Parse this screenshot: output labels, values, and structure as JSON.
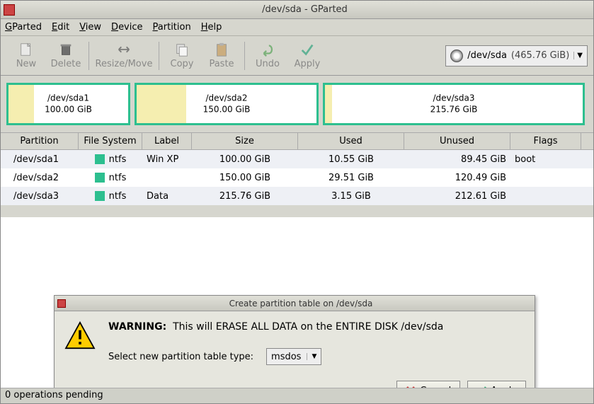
{
  "titlebar": {
    "title": "/dev/sda - GParted"
  },
  "menu": {
    "gparted": "GParted",
    "edit": "Edit",
    "view": "View",
    "device": "Device",
    "partition": "Partition",
    "help": "Help"
  },
  "toolbar": {
    "new": "New",
    "delete": "Delete",
    "resize": "Resize/Move",
    "copy": "Copy",
    "paste": "Paste",
    "undo": "Undo",
    "apply": "Apply"
  },
  "device": {
    "name": "/dev/sda",
    "size": "(465.76 GiB)"
  },
  "partitions": [
    {
      "name": "/dev/sda1",
      "fs": "ntfs",
      "label": "Win XP",
      "size": "100.00 GiB",
      "used": "10.55 GiB",
      "unused": "89.45 GiB",
      "flags": "boot",
      "vis_width": 175,
      "vis_used": 36
    },
    {
      "name": "/dev/sda2",
      "fs": "ntfs",
      "label": "",
      "size": "150.00 GiB",
      "used": "29.51 GiB",
      "unused": "120.49 GiB",
      "flags": "",
      "vis_width": 260,
      "vis_used": 70
    },
    {
      "name": "/dev/sda3",
      "fs": "ntfs",
      "label": "Data",
      "size": "215.76 GiB",
      "used": "3.15 GiB",
      "unused": "212.61 GiB",
      "flags": "",
      "vis_width": 370,
      "vis_used": 10
    }
  ],
  "columns": {
    "partition": "Partition",
    "filesystem": "File System",
    "label": "Label",
    "size": "Size",
    "used": "Used",
    "unused": "Unused",
    "flags": "Flags"
  },
  "dialog": {
    "title": "Create partition table on /dev/sda",
    "warning_label": "WARNING:",
    "warning_text": "This will ERASE ALL DATA on the ENTIRE DISK /dev/sda",
    "select_label": "Select new partition table type:",
    "selected_type": "msdos",
    "cancel": "Cancel",
    "apply": "Apply"
  },
  "status": "0 operations pending"
}
